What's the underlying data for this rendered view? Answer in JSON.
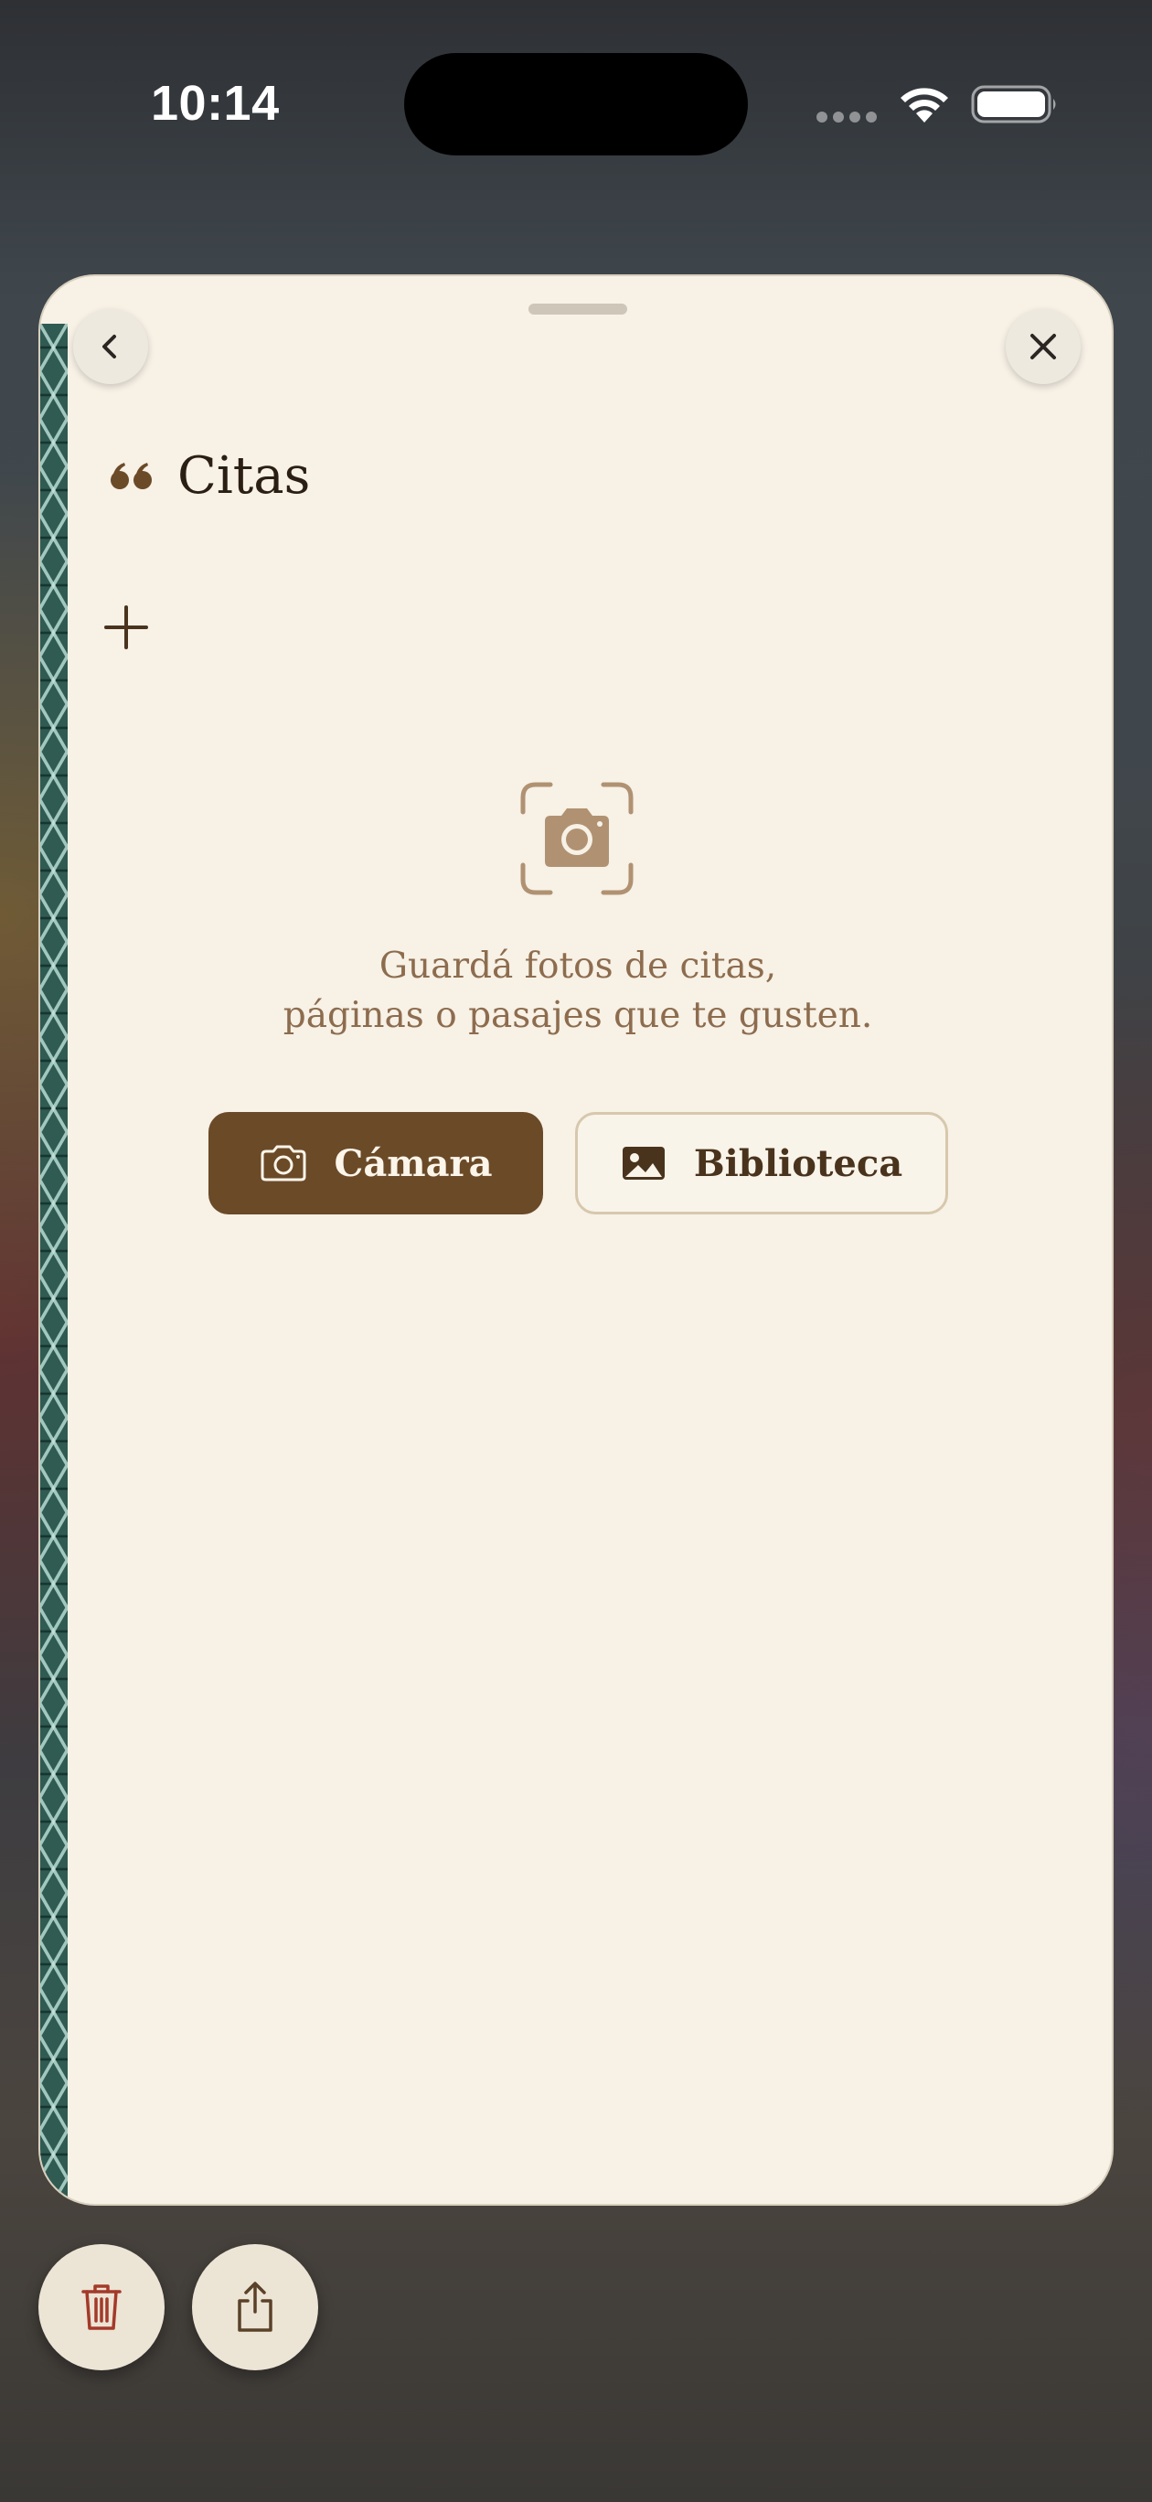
{
  "status_bar": {
    "time": "10:14"
  },
  "sheet": {
    "title": "Citas",
    "empty_state": {
      "line1": "Guardá fotos de citas,",
      "line2": "páginas o pasajes que te gusten."
    },
    "buttons": {
      "camera_label": "Cámara",
      "library_label": "Biblioteca"
    }
  },
  "icons": {
    "back": "chevron-left-icon",
    "close": "close-icon",
    "title": "quote-icon",
    "add": "plus-icon",
    "empty": "camera-viewfinder-icon",
    "camera_button": "camera-icon",
    "library_button": "photo-icon",
    "delete": "trash-icon",
    "share": "share-icon"
  },
  "colors": {
    "sheet_background": "#f7f1e6",
    "accent_brown": "#6b4a28",
    "muted_text": "#8d6c4e",
    "delete_red": "#a33a2a",
    "spine_green": "#2f5b52"
  }
}
